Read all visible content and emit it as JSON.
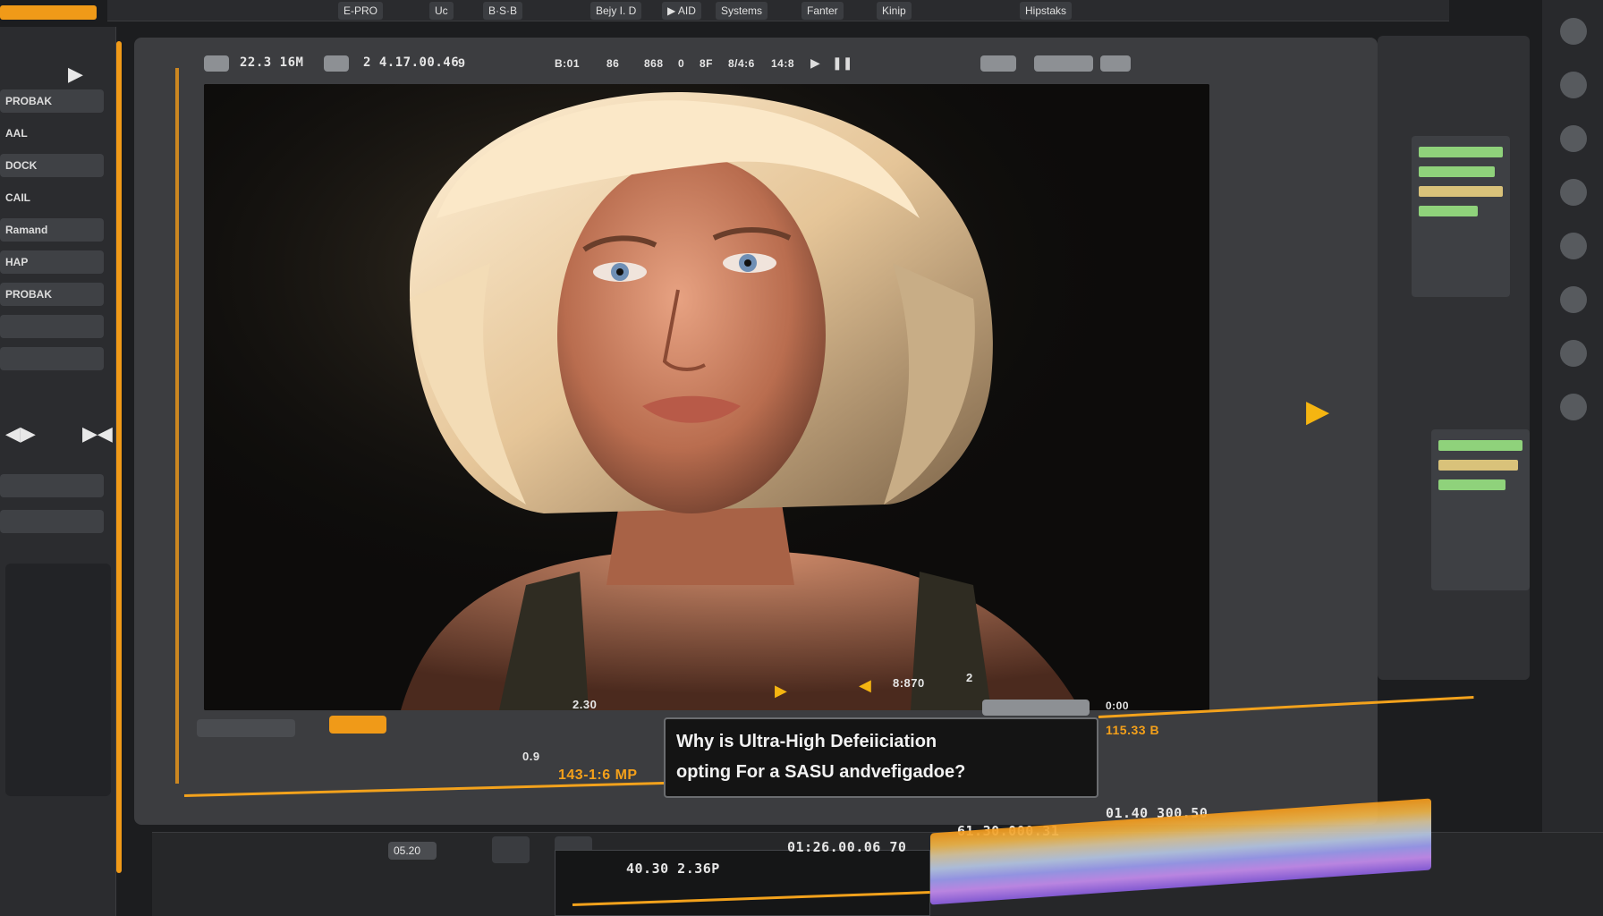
{
  "menubar": {
    "items": [
      "E-PRO",
      "Uc",
      "B·S·B",
      "Bejy I. D",
      "▶ AID",
      "Systems",
      "Fanter",
      "Kinip",
      "Hipstaks"
    ]
  },
  "viewer": {
    "timecode_left": "22.3 16M",
    "timecode_right": "2 4.17.00.46",
    "counter": "9",
    "transport_readout": [
      "B:01",
      "86",
      "868",
      "0",
      "8F",
      "8/4:6",
      "14:8"
    ],
    "bottom_readout": "2.30",
    "bottom_counter": "2",
    "bottom_time": "8:870",
    "mp_label": "143-1:6 MP",
    "mp_small": "0.9",
    "right_tag": "115.33 B",
    "small_label": "0:00"
  },
  "subtitle": {
    "line1": "Why is  Ultra-High Defeiiciation",
    "line2": "opting For a SASU andvefigadoe?"
  },
  "timeline": {
    "time_a": "40.30 2.36P",
    "time_b": "01:26.00.06 70",
    "time_c": "61.30.000.31",
    "time_d": "01.40 300.50",
    "left_label": "05.20"
  },
  "left_panel": {
    "rows": [
      "PROBAK",
      "AAL",
      "DOCK",
      "CAIL",
      "Ramand",
      "HAP",
      "PROBAK"
    ]
  },
  "colors": {
    "accent": "#f09a18",
    "meter_green": "#8fd27b",
    "meter_amber": "#d9c27a"
  },
  "icons": [
    "play-icon",
    "pause-icon",
    "skip-back-icon",
    "skip-forward-icon",
    "marker-icon",
    "settings-icon"
  ]
}
